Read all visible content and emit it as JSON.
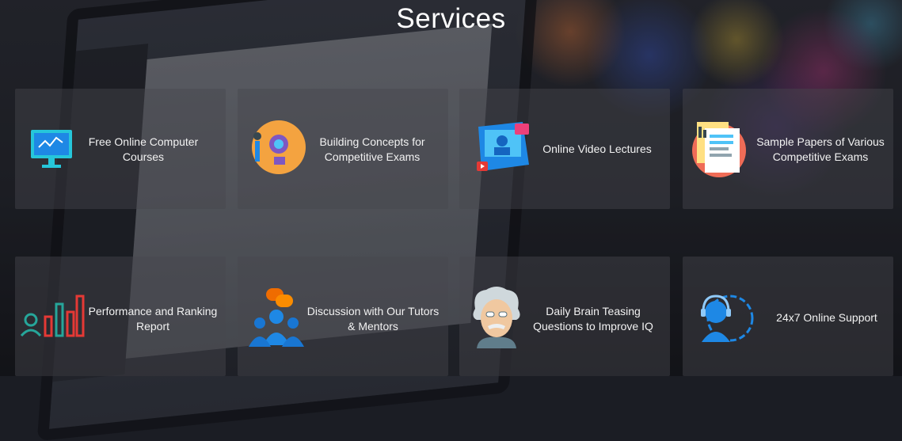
{
  "section": {
    "title": "Services"
  },
  "services": [
    {
      "label": "Free Online Computer Courses",
      "icon": "computer-monitor-icon"
    },
    {
      "label": "Building Concepts for Competitive Exams",
      "icon": "concept-idea-icon"
    },
    {
      "label": "Online Video Lectures",
      "icon": "video-lecture-icon"
    },
    {
      "label": "Sample Papers of Various Competitive Exams",
      "icon": "sample-papers-icon"
    },
    {
      "label": "Performance and Ranking Report",
      "icon": "performance-chart-icon"
    },
    {
      "label": "Discussion with Our Tutors & Mentors",
      "icon": "discussion-group-icon"
    },
    {
      "label": "Daily Brain Teasing Questions to Improve IQ",
      "icon": "einstein-icon"
    },
    {
      "label": "24x7 Online Support",
      "icon": "support-headset-icon"
    }
  ],
  "colors": {
    "card_bg": "#46484e",
    "text": "#ffffff",
    "accent_blue": "#1e88e5",
    "accent_red": "#e53935"
  }
}
